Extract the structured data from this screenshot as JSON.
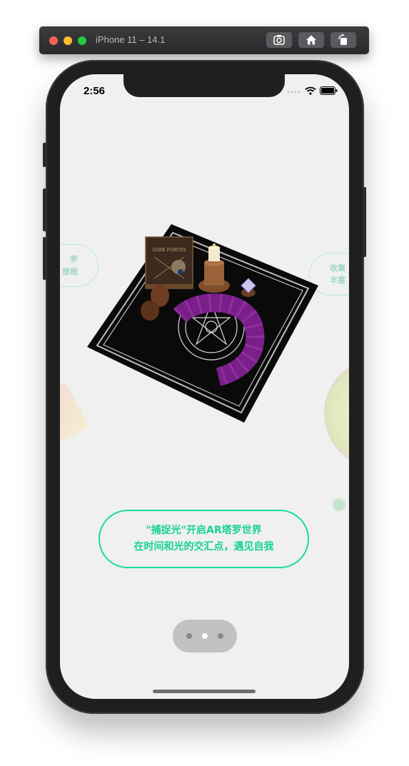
{
  "simulator": {
    "title": "iPhone 11 – 14.1",
    "buttons": [
      "screenshot-icon",
      "home-icon",
      "rotate-icon"
    ]
  },
  "status_bar": {
    "time": "2:56",
    "icons": [
      "signal-icon",
      "wifi-icon",
      "battery-icon"
    ]
  },
  "left_card": {
    "line1": "罗",
    "line2": "旅程"
  },
  "right_card": {
    "line1": "收集",
    "line2": "丰富"
  },
  "scene": {
    "book_title": "DARK FORCES",
    "colors": {
      "cloth": "#000000",
      "cards": "#7a1f8a",
      "accent": "#19dc96"
    }
  },
  "caption": {
    "line1": "\"捕捉光\"开启AR塔罗世界",
    "line2": "在时间和光的交汇点，遇见自我"
  },
  "pager": {
    "count": 3,
    "active": 1
  }
}
